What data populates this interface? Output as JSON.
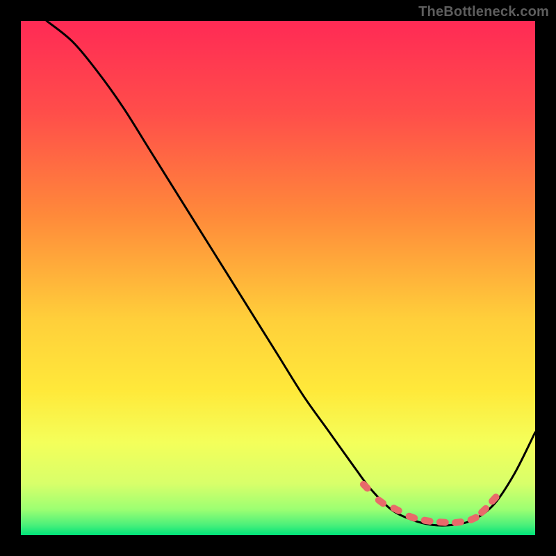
{
  "watermark": "TheBottleneck.com",
  "chart_data": {
    "type": "line",
    "title": "",
    "xlabel": "",
    "ylabel": "",
    "xlim": [
      0,
      100
    ],
    "ylim": [
      0,
      100
    ],
    "grid": false,
    "legend": false,
    "background_gradient": {
      "top": "#ff2a55",
      "mid_upper": "#ff8a3a",
      "mid": "#ffe93a",
      "mid_lower": "#d8ff6a",
      "bottom": "#00e37a"
    },
    "series": [
      {
        "name": "bottleneck-curve",
        "color": "#000000",
        "x": [
          5,
          10,
          15,
          20,
          25,
          30,
          35,
          40,
          45,
          50,
          55,
          60,
          65,
          68,
          72,
          76,
          80,
          84,
          88,
          92,
          96,
          100
        ],
        "y": [
          100,
          96,
          90,
          83,
          75,
          67,
          59,
          51,
          43,
          35,
          27,
          20,
          13,
          9,
          5,
          3,
          2,
          2,
          3,
          6,
          12,
          20
        ]
      }
    ],
    "marker_points": {
      "name": "optimal-range-markers",
      "color": "#e86a6a",
      "shape": "rounded-rect",
      "x": [
        67,
        70,
        73,
        76,
        79,
        82,
        85,
        88,
        90,
        92
      ],
      "y": [
        9.5,
        6.5,
        5,
        3.5,
        2.8,
        2.5,
        2.5,
        3.2,
        4.8,
        7
      ]
    }
  }
}
